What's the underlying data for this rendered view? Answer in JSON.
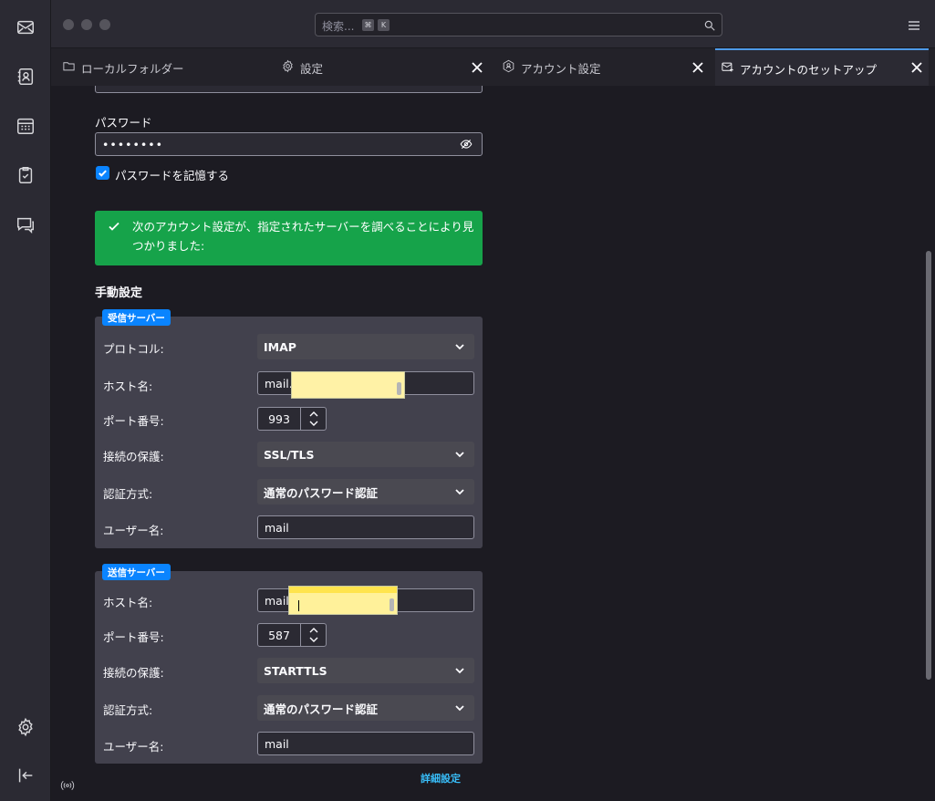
{
  "titlebar": {
    "search_placeholder": "検索...",
    "shortcut_keys": [
      "⌘",
      "K"
    ]
  },
  "tabs": [
    {
      "label": "ローカルフォルダー",
      "icon": "folder-icon",
      "closable": false
    },
    {
      "label": "設定",
      "icon": "gear-icon",
      "closable": true
    },
    {
      "label": "アカウント設定",
      "icon": "account-settings-icon",
      "closable": true
    },
    {
      "label": "アカウントのセットアップ",
      "icon": "mail-setup-icon",
      "closable": true,
      "active": true
    }
  ],
  "spaces": [
    "mail-icon",
    "address-book-icon",
    "calendar-icon",
    "tasks-icon",
    "chat-icon",
    "settings-icon",
    "collapse-icon"
  ],
  "password": {
    "label": "パスワード",
    "value": "••••••••",
    "remember_label": "パスワードを記憶する",
    "remember_checked": true
  },
  "notice": {
    "message": "次のアカウント設定が、指定されたサーバーを調べることにより見つかりました:",
    "color": "#16a34a"
  },
  "manual": {
    "heading": "手動設定",
    "incoming": {
      "legend": "受信サーバー",
      "protocol_label": "プロトコル:",
      "protocol_value": "IMAP",
      "hostname_label": "ホスト名:",
      "hostname_value": "mail.",
      "port_label": "ポート番号:",
      "port_value": "993",
      "security_label": "接続の保護:",
      "security_value": "SSL/TLS",
      "auth_label": "認証方式:",
      "auth_value": "通常のパスワード認証",
      "username_label": "ユーザー名:",
      "username_value": "mail"
    },
    "outgoing": {
      "legend": "送信サーバー",
      "hostname_label": "ホスト名:",
      "hostname_value": "mail.",
      "port_label": "ポート番号:",
      "port_value": "587",
      "security_label": "接続の保護:",
      "security_value": "STARTTLS",
      "auth_label": "認証方式:",
      "auth_value": "通常のパスワード認証",
      "username_label": "ユーザー名:",
      "username_value": "mail"
    },
    "advanced_link": "詳細設定"
  },
  "colors": {
    "accent": "#0a84ff",
    "success": "#16a34a",
    "link": "#38bdf8",
    "redaction": "#fff2a6"
  }
}
